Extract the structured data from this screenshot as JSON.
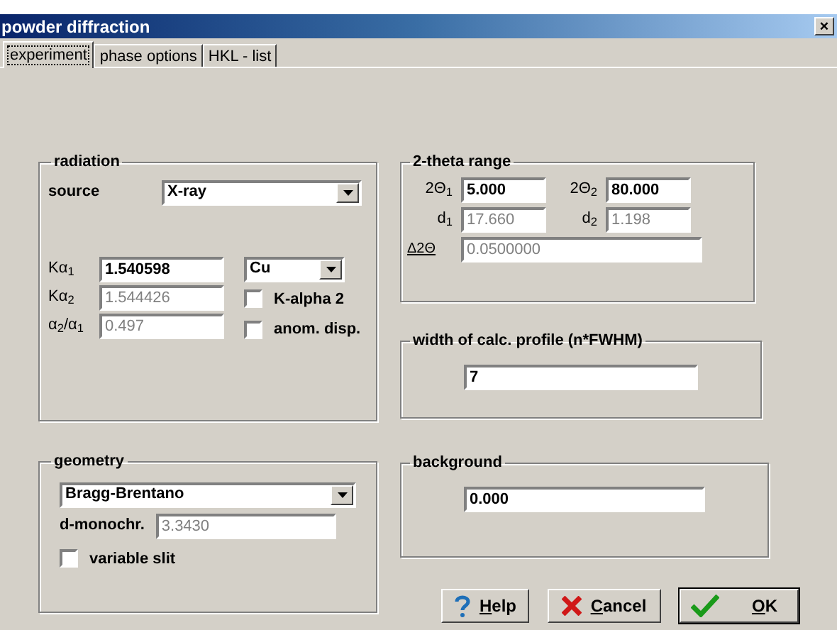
{
  "window": {
    "title": "powder diffraction",
    "close": "×"
  },
  "tabs": [
    {
      "label": "experiment",
      "selected": true
    },
    {
      "label": "phase options",
      "selected": false
    },
    {
      "label": "HKL - list",
      "selected": false
    }
  ],
  "radiation": {
    "title": "radiation",
    "source": {
      "label": "source",
      "value": "X-ray"
    },
    "fields": [
      {
        "label": "Kα$_{1}$",
        "value": "1.540598",
        "disabled": false
      },
      {
        "label": "Kα$_{2}$",
        "value": "1.544426",
        "disabled": true
      },
      {
        "label": "α$_{2}$/α$_{1}$",
        "value": "0.497",
        "disabled": true
      }
    ],
    "anode": {
      "value": "Cu"
    },
    "checkboxes": [
      {
        "label": "K-alpha 2",
        "checked": false
      },
      {
        "label": "anom. disp.",
        "checked": false
      }
    ]
  },
  "geometry": {
    "title": "geometry",
    "mode": "Bragg-Brentano",
    "monochromator": {
      "label": "d-monochr.",
      "value": "3.3430",
      "disabled": true
    },
    "checkboxes": [
      {
        "label": "variable slit",
        "checked": false
      }
    ]
  },
  "theta_range": {
    "title": "2-theta range",
    "fields": [
      {
        "label": "2Θ$_{1}$",
        "value": "5.000",
        "disabled": false
      },
      {
        "label": "2Θ$_{2}$",
        "value": "80.000",
        "disabled": false
      },
      {
        "label": "d$_{1}$",
        "value": "17.660",
        "disabled": true
      },
      {
        "label": "d$_{2}$",
        "value": "1.198",
        "disabled": true
      }
    ],
    "step": {
      "label": "Δ2Θ",
      "value": "0.0500000",
      "disabled": true
    }
  },
  "profile": {
    "title": "width of calc. profile  (n*FWHM)",
    "value": "7"
  },
  "background": {
    "title": "background",
    "value": "0.000"
  },
  "buttons": [
    {
      "kind": "help",
      "label": "Help"
    },
    {
      "kind": "cancel",
      "label": "Cancel"
    },
    {
      "kind": "ok",
      "label": "OK"
    }
  ]
}
